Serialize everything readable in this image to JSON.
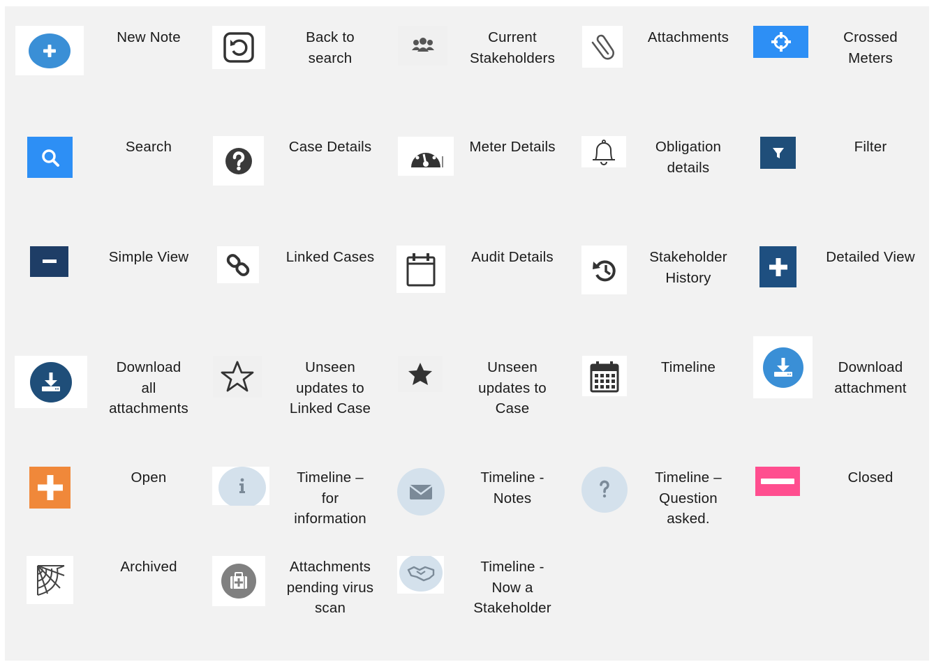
{
  "legend": {
    "row1": {
      "new_note": "New Note",
      "back_to_search": [
        "Back to",
        "search"
      ],
      "current_stakeholders": [
        "Current",
        "Stakeholders"
      ],
      "attachments": "Attachments",
      "crossed_meters": [
        "Crossed",
        "Meters"
      ]
    },
    "row2": {
      "search": "Search",
      "case_details": "Case Details",
      "meter_details": "Meter Details",
      "obligation_details": [
        "Obligation",
        "details"
      ],
      "filter": "Filter"
    },
    "row3": {
      "simple_view": "Simple View",
      "linked_cases": "Linked Cases",
      "audit_details": "Audit Details",
      "stakeholder_history": [
        "Stakeholder",
        "History"
      ],
      "detailed_view": "Detailed View"
    },
    "row4": {
      "download_all": [
        "Download",
        "all",
        "attachments"
      ],
      "unseen_linked": [
        "Unseen",
        "updates to",
        "Linked Case"
      ],
      "unseen_case": [
        "Unseen",
        "updates to",
        "Case"
      ],
      "timeline": "Timeline",
      "download_attachment": [
        "Download",
        "attachment"
      ]
    },
    "row5": {
      "open": "Open",
      "timeline_info": [
        "Timeline –",
        "for",
        "information"
      ],
      "timeline_notes": [
        "Timeline -",
        "Notes"
      ],
      "timeline_question": [
        "Timeline –",
        "Question",
        "asked."
      ],
      "closed": "Closed"
    },
    "row6": {
      "archived": "Archived",
      "pending_scan": [
        "Attachments",
        "pending virus",
        "scan"
      ],
      "now_stakeholder": [
        "Timeline -",
        "Now a",
        "Stakeholder"
      ]
    }
  },
  "icons": {
    "new_note": "plus-circle-icon",
    "back_to_search": "undo-square-icon",
    "current_stakeholders": "users-icon",
    "attachments": "paperclip-icon",
    "crossed_meters": "crosshairs-icon",
    "search": "search-icon",
    "case_details": "question-circle-icon",
    "meter_details": "dashboard-gauge-icon",
    "obligation_details": "bell-icon",
    "filter": "filter-icon",
    "simple_view": "minus-square-icon",
    "linked_cases": "chain-link-icon",
    "audit_details": "calendar-blank-icon",
    "stakeholder_history": "history-icon",
    "detailed_view": "plus-square-icon",
    "download_all": "download-circle-icon",
    "unseen_linked": "star-outline-icon",
    "unseen_case": "star-filled-icon",
    "timeline": "calendar-grid-icon",
    "download_attachment": "download-circle-icon",
    "open": "plus-square-icon",
    "timeline_info": "info-icon",
    "timeline_notes": "envelope-icon",
    "timeline_question": "question-icon",
    "closed": "minus-icon",
    "archived": "spider-web-icon",
    "pending_scan": "medkit-icon",
    "now_stakeholder": "handshake-icon"
  },
  "colors": {
    "panel_background": "#f2f2f2",
    "blue_light": "#3a8fd6",
    "blue_bright": "#2d8ff5",
    "navy": "#1f4e79",
    "navy_dark": "#1e3d66",
    "dark_grey": "#3a3a3a",
    "orange": "#f0883a",
    "pink": "#ff4e8f",
    "timeline_circle": "#d4e1ec",
    "timeline_glyph": "#7b8a98"
  }
}
